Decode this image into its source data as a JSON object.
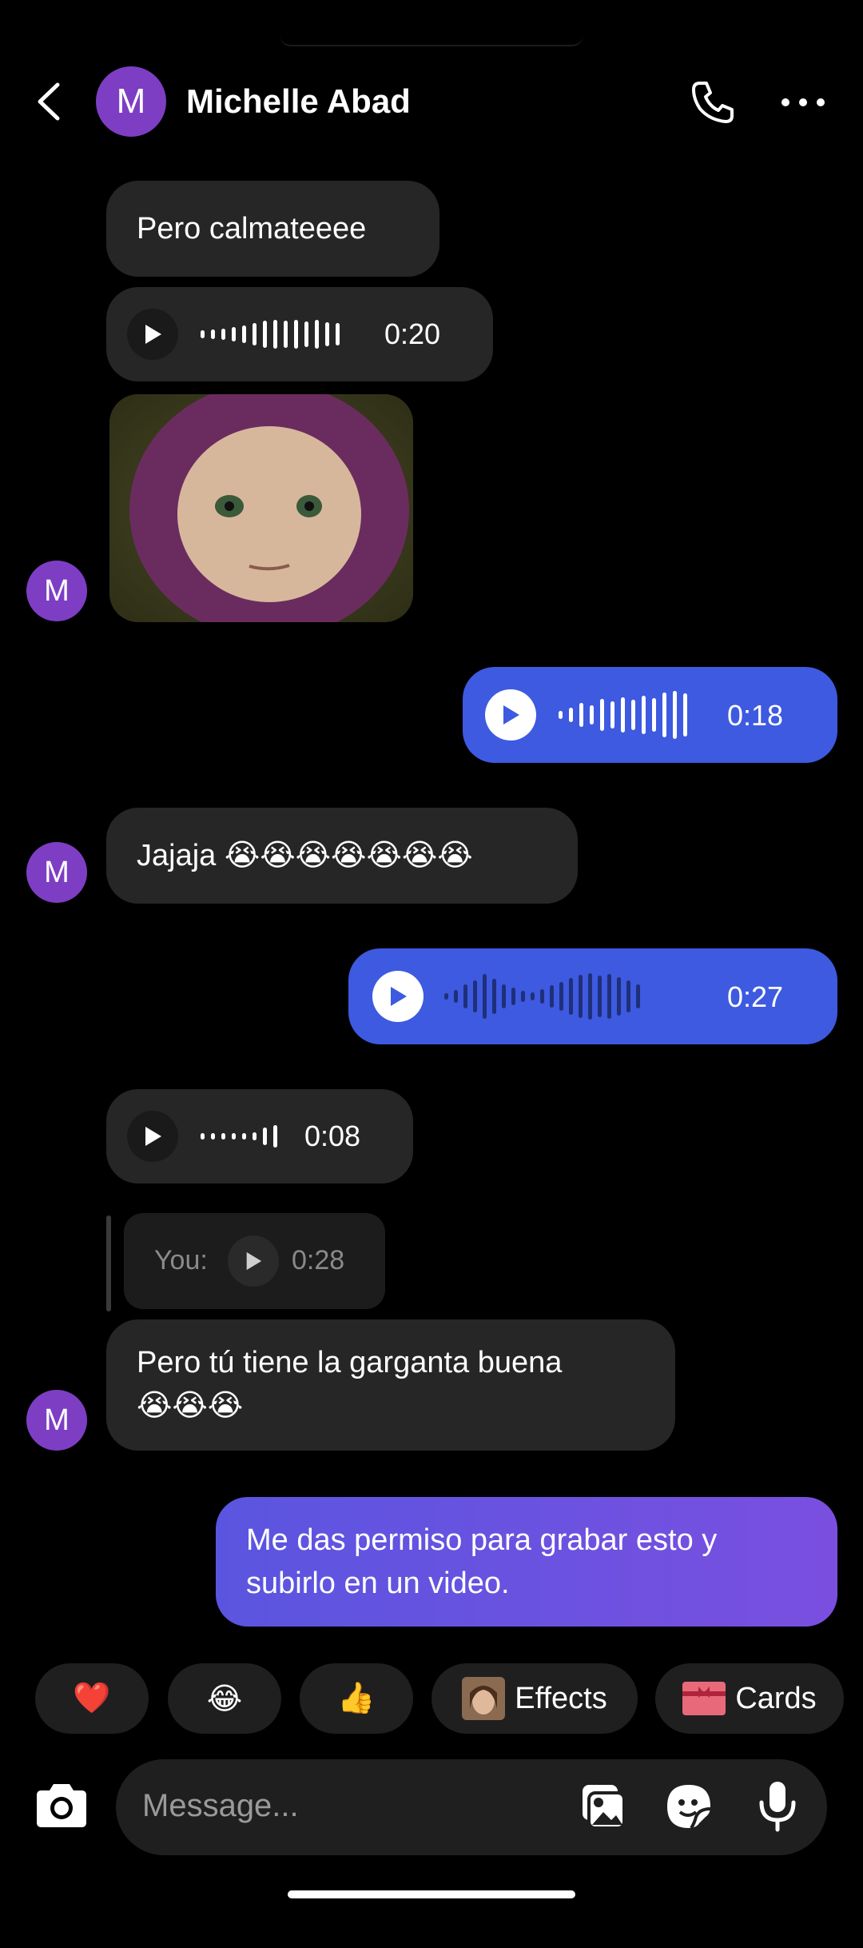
{
  "header": {
    "contact_name": "Michelle Abad",
    "avatar_initial": "M"
  },
  "messages": {
    "m1_text": "Pero calmateeee",
    "m2_duration": "0:20",
    "m4_duration": "0:18",
    "m5_text": "Jajaja 😭😭😭😭😭😭😭",
    "m6_duration": "0:27",
    "m7_duration": "0:08",
    "reply_label": "You:",
    "reply_duration": "0:28",
    "m8_line1": "Pero tú tiene la garganta buena",
    "m8_line2": "😭😭😭",
    "m9_line1": "Me das permiso para grabar esto y",
    "m9_line2": "subirlo en un video."
  },
  "quick_replies": {
    "heart": "❤️",
    "laugh": "😂",
    "thumbs": "👍",
    "effects": "Effects",
    "cards": "Cards"
  },
  "composer": {
    "placeholder": "Message..."
  },
  "colors": {
    "outgoing": "#3d5ae0",
    "outgoing_gradient_end": "#7b4fe0",
    "incoming": "#262626",
    "avatar": "#7d3ec4"
  }
}
